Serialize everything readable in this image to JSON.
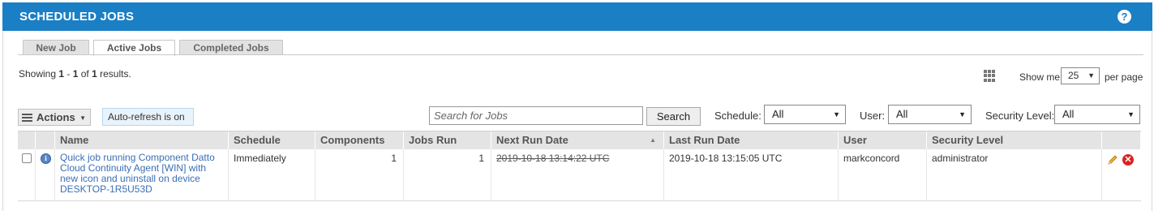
{
  "header": {
    "title": "SCHEDULED JOBS",
    "help_icon": "?"
  },
  "tabs": [
    {
      "label": "New Job"
    },
    {
      "label": "Active Jobs",
      "active": true
    },
    {
      "label": "Completed Jobs"
    }
  ],
  "pagination": {
    "showing_prefix": "Showing ",
    "from": "1",
    "dash": " - ",
    "to": "1",
    "of": " of ",
    "total": "1",
    "suffix": " results.",
    "show_me_label": "Show me",
    "per_page_value": "25",
    "per_page_label": "per page"
  },
  "toolbar": {
    "actions_label": "Actions",
    "autorefresh_label": "Auto-refresh is on",
    "search_placeholder": "Search for Jobs",
    "search_button": "Search",
    "schedule_label": "Schedule:",
    "schedule_value": "All",
    "user_label": "User:",
    "user_value": "All",
    "security_label": "Security Level:",
    "security_value": "All"
  },
  "table": {
    "columns": [
      "Name",
      "Schedule",
      "Components",
      "Jobs Run",
      "Next Run Date",
      "Last Run Date",
      "User",
      "Security Level"
    ],
    "rows": [
      {
        "name": "Quick job running Component Datto Cloud Continuity Agent [WIN] with new icon and uninstall on device DESKTOP-1R5U53D",
        "schedule": "Immediately",
        "components": "1",
        "jobs_run": "1",
        "next_run_date": "2019-10-18 13:14:22 UTC",
        "last_run_date": "2019-10-18 13:15:05 UTC",
        "user": "markconcord",
        "security_level": "administrator"
      }
    ]
  },
  "colors": {
    "header_bg": "#1a7fc4",
    "link": "#3a6fb5",
    "delete": "#d82323"
  }
}
